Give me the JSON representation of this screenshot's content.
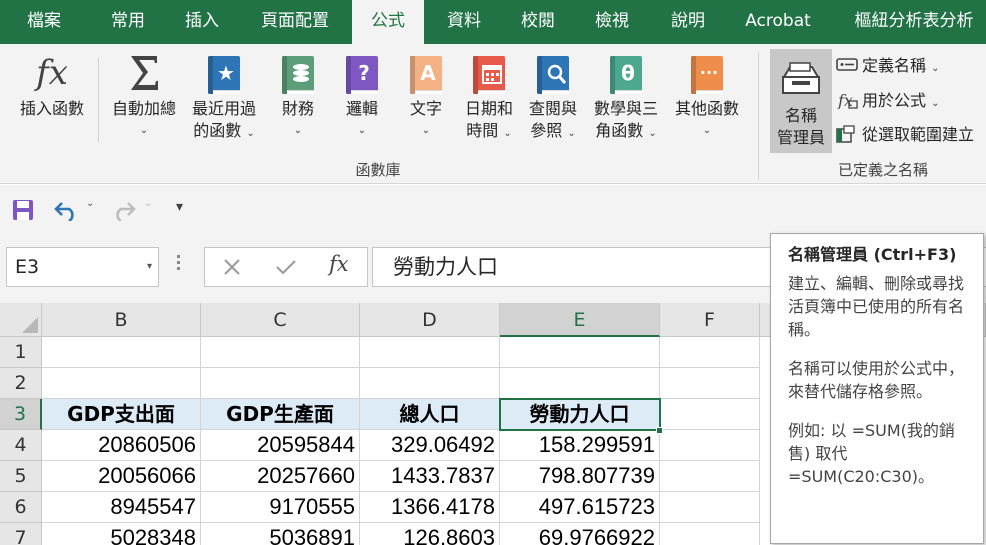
{
  "tabs": [
    {
      "id": "file",
      "label": "檔案"
    },
    {
      "id": "home",
      "label": "常用"
    },
    {
      "id": "insert",
      "label": "插入"
    },
    {
      "id": "page-layout",
      "label": "頁面配置"
    },
    {
      "id": "formulas",
      "label": "公式",
      "active": true
    },
    {
      "id": "data",
      "label": "資料"
    },
    {
      "id": "review",
      "label": "校閱"
    },
    {
      "id": "view",
      "label": "檢視"
    },
    {
      "id": "help",
      "label": "說明"
    },
    {
      "id": "acrobat",
      "label": "Acrobat"
    },
    {
      "id": "pivot-analyze",
      "label": "樞紐分析表分析"
    }
  ],
  "ribbon": {
    "insert_function": {
      "line1": "插入函數",
      "icon": "fx-icon"
    },
    "autosum": {
      "line1": "自動加總",
      "icon": "sigma-icon"
    },
    "recent": {
      "line1": "最近用過",
      "line2": "的函數"
    },
    "financial": {
      "line1": "財務"
    },
    "logical": {
      "line1": "邏輯",
      "glyph": "?"
    },
    "text": {
      "line1": "文字",
      "glyph": "A"
    },
    "datetime": {
      "line1": "日期和",
      "line2": "時間"
    },
    "lookup": {
      "line1": "查閱與",
      "line2": "參照"
    },
    "math": {
      "line1": "數學與三",
      "line2": "角函數",
      "glyph": "θ"
    },
    "more": {
      "line1": "其他函數",
      "glyph": "···"
    },
    "function_library_label": "函數庫",
    "name_manager": {
      "line1": "名稱",
      "line2": "管理員"
    },
    "define_name": "定義名稱",
    "use_in_formula": "用於公式",
    "create_from_selection": "從選取範圍建立",
    "defined_names_label": "已定義之名稱",
    "colors": {
      "recent": "#2e75b6",
      "financial": "#5b9e79",
      "logical": "#7e57c2",
      "text": "#f4b183",
      "datetime": "#e85b4a",
      "lookup": "#2e75b6",
      "math": "#4ca88f",
      "more": "#ef8e4a"
    }
  },
  "qat": {
    "save": "save-icon",
    "undo": "undo-icon",
    "redo": "redo-icon",
    "customize": "▾"
  },
  "formula_bar": {
    "name_box": "E3",
    "fx": "fx",
    "content": "勞動力人口"
  },
  "grid": {
    "columns": [
      "B",
      "C",
      "D",
      "E",
      "F"
    ],
    "rows": [
      "1",
      "2",
      "3",
      "4",
      "5",
      "6",
      "7"
    ],
    "header_row": [
      "GDP支出面",
      "GDP生產面",
      "總人口",
      "勞動力人口"
    ],
    "data": [
      [
        "20860506",
        "20595844",
        "329.06492",
        "158.299591"
      ],
      [
        "20056066",
        "20257660",
        "1433.7837",
        "798.807739"
      ],
      [
        "8945547",
        "9170555",
        "1366.4178",
        "497.615723"
      ],
      [
        "5028348",
        "5036891",
        "126.8603",
        "69.9766922"
      ]
    ],
    "active_cell": "E3"
  },
  "tooltip": {
    "title": "名稱管理員 (Ctrl+F3)",
    "p1": "建立、編輯、刪除或尋找活頁簿中已使用的所有名稱。",
    "p2": "名稱可以使用於公式中，來替代儲存格參照。",
    "p3": "例如: 以 =SUM(我的銷售) 取代 =SUM(C20:C30)。"
  }
}
